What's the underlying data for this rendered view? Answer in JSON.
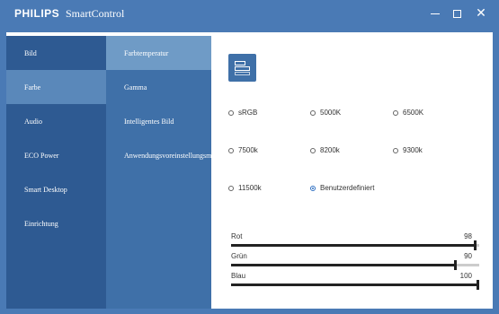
{
  "window": {
    "brand": "PHILIPS",
    "app_name": "SmartControl"
  },
  "nav_main": [
    {
      "label": "Bild",
      "active": false
    },
    {
      "label": "Farbe",
      "active": true
    },
    {
      "label": "Audio",
      "active": false
    },
    {
      "label": "ECO Power",
      "active": false
    },
    {
      "label": "Smart Desktop",
      "active": false
    },
    {
      "label": "Einrichtung",
      "active": false
    }
  ],
  "nav_sub": [
    {
      "label": "Farbtemperatur",
      "active": true
    },
    {
      "label": "Gamma",
      "active": false
    },
    {
      "label": "Intelligentes Bild",
      "active": false
    },
    {
      "label": "Anwendungsvoreinstellungsmodus",
      "active": false
    }
  ],
  "color_temperature": {
    "options": [
      "sRGB",
      "5000K",
      "6500K",
      "7500k",
      "8200k",
      "9300k",
      "11500k",
      "Benutzerdefiniert"
    ],
    "selected": "Benutzerdefiniert"
  },
  "sliders": [
    {
      "label": "Rot",
      "value": "98",
      "level": 98
    },
    {
      "label": "Grün",
      "value": "90",
      "level": 90
    },
    {
      "label": "Blau",
      "value": "100",
      "level": 100
    }
  ],
  "colors": {
    "titlebar": "#4a7ab5",
    "nav_main_bg": "#2e5a92",
    "nav_sub_bg": "#3f70a8",
    "selected_radio": "#2e6fc2"
  }
}
